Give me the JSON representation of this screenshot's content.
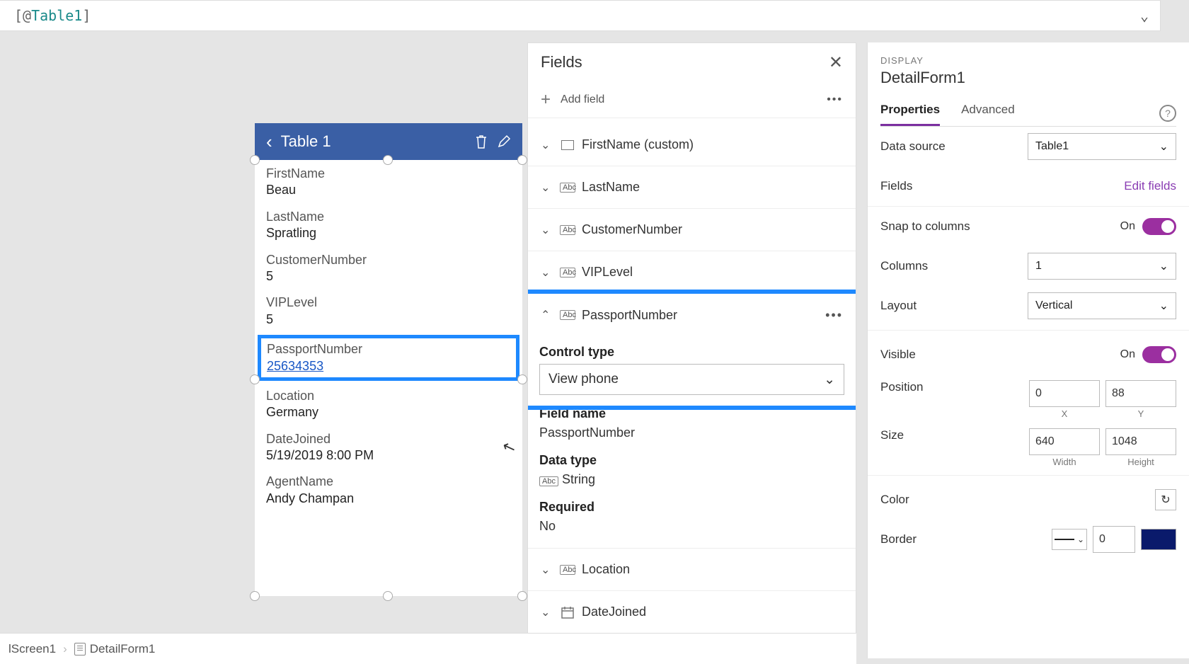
{
  "formula": "[@Table1]",
  "phone": {
    "title": "Table 1",
    "fields": [
      {
        "label": "FirstName",
        "value": "Beau"
      },
      {
        "label": "LastName",
        "value": "Spratling"
      },
      {
        "label": "CustomerNumber",
        "value": "5"
      },
      {
        "label": "VIPLevel",
        "value": "5"
      }
    ],
    "passport": {
      "label": "PassportNumber",
      "value": "25634353"
    },
    "fields2": [
      {
        "label": "Location",
        "value": "Germany"
      },
      {
        "label": "DateJoined",
        "value": "5/19/2019 8:00 PM"
      },
      {
        "label": "AgentName",
        "value": "Andy Champan"
      }
    ]
  },
  "fieldsPanel": {
    "title": "Fields",
    "addField": "Add field",
    "items": [
      {
        "label": "FirstName (custom)",
        "typeIcon": "rect"
      },
      {
        "label": "LastName",
        "typeIcon": "abc"
      },
      {
        "label": "CustomerNumber",
        "typeIcon": "abc"
      },
      {
        "label": "VIPLevel",
        "typeIcon": "abc"
      }
    ],
    "expanded": {
      "label": "PassportNumber",
      "controlTypeLabel": "Control type",
      "controlTypeValue": "View phone",
      "fieldNameLabel": "Field name",
      "fieldNameValue": "PassportNumber",
      "dataTypeLabel": "Data type",
      "dataTypeValue": "String",
      "requiredLabel": "Required",
      "requiredValue": "No"
    },
    "itemsAfter": [
      {
        "label": "Location",
        "typeIcon": "abc"
      },
      {
        "label": "DateJoined",
        "typeIcon": "cal"
      }
    ]
  },
  "props": {
    "caption": "DISPLAY",
    "objectName": "DetailForm1",
    "tabs": {
      "properties": "Properties",
      "advanced": "Advanced"
    },
    "dataSourceLabel": "Data source",
    "dataSourceValue": "Table1",
    "fieldsLabel": "Fields",
    "editFields": "Edit fields",
    "snapLabel": "Snap to columns",
    "snapValue": "On",
    "columnsLabel": "Columns",
    "columnsValue": "1",
    "layoutLabel": "Layout",
    "layoutValue": "Vertical",
    "visibleLabel": "Visible",
    "visibleValue": "On",
    "positionLabel": "Position",
    "positionX": "0",
    "positionY": "88",
    "xLabel": "X",
    "yLabel": "Y",
    "sizeLabel": "Size",
    "sizeW": "640",
    "sizeH": "1048",
    "wLabel": "Width",
    "hLabel": "Height",
    "colorLabel": "Color",
    "borderLabel": "Border",
    "borderValue": "0"
  },
  "breadcrumb": {
    "screen": "lScreen1",
    "form": "DetailForm1"
  }
}
